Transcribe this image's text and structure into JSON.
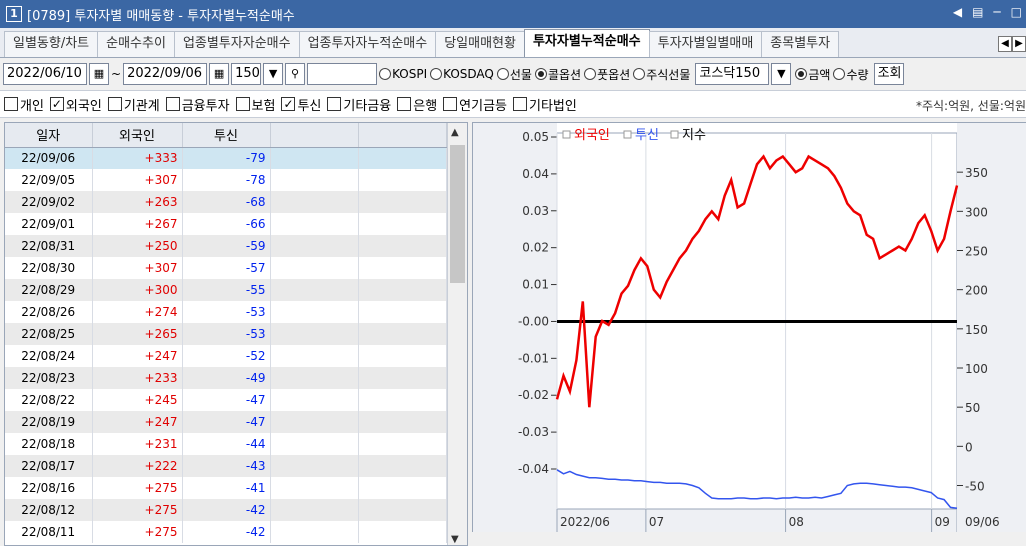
{
  "titlebar": {
    "window_number": "1",
    "title": "[0789] 투자자별 매매동향 - 투자자별누적순매수",
    "controls": [
      "◀",
      "▤",
      "─",
      "□"
    ]
  },
  "tabs": [
    {
      "label": "일별동향/차트",
      "active": false
    },
    {
      "label": "순매수추이",
      "active": false
    },
    {
      "label": "업종별투자자순매수",
      "active": false
    },
    {
      "label": "업종투자자누적순매수",
      "active": false
    },
    {
      "label": "당일매매현황",
      "active": false
    },
    {
      "label": "투자자별누적순매수",
      "active": true
    },
    {
      "label": "투자자별일별매매",
      "active": false
    },
    {
      "label": "종목별투자",
      "active": false
    }
  ],
  "toolbar": {
    "start_date": "2022/06/10",
    "range_sep": "~",
    "end_date": "2022/09/06",
    "count": "150",
    "search_icon": "search-icon",
    "market_options": [
      {
        "label": "KOSPI",
        "selected": false
      },
      {
        "label": "KOSDAQ",
        "selected": false
      },
      {
        "label": "선물",
        "selected": false
      },
      {
        "label": "콜옵션",
        "selected": true
      },
      {
        "label": "풋옵션",
        "selected": false
      },
      {
        "label": "주식선물",
        "selected": false
      }
    ],
    "combo_value": "코스닥150",
    "unit_options": [
      {
        "label": "금액",
        "selected": true
      },
      {
        "label": "수량",
        "selected": false
      }
    ],
    "query_button": "조회"
  },
  "investors": [
    {
      "label": "개인",
      "checked": false
    },
    {
      "label": "외국인",
      "checked": true
    },
    {
      "label": "기관계",
      "checked": false
    },
    {
      "label": "금융투자",
      "checked": false
    },
    {
      "label": "보험",
      "checked": false
    },
    {
      "label": "투신",
      "checked": true
    },
    {
      "label": "기타금융",
      "checked": false
    },
    {
      "label": "은행",
      "checked": false
    },
    {
      "label": "연기금등",
      "checked": false
    },
    {
      "label": "기타법인",
      "checked": false
    }
  ],
  "unit_note": "*주식:억원, 선물:억원",
  "grid": {
    "headers": [
      "일자",
      "외국인",
      "투신",
      "",
      ""
    ],
    "rows": [
      [
        "22/09/06",
        "+333",
        "-79"
      ],
      [
        "22/09/05",
        "+307",
        "-78"
      ],
      [
        "22/09/02",
        "+263",
        "-68"
      ],
      [
        "22/09/01",
        "+267",
        "-66"
      ],
      [
        "22/08/31",
        "+250",
        "-59"
      ],
      [
        "22/08/30",
        "+307",
        "-57"
      ],
      [
        "22/08/29",
        "+300",
        "-55"
      ],
      [
        "22/08/26",
        "+274",
        "-53"
      ],
      [
        "22/08/25",
        "+265",
        "-53"
      ],
      [
        "22/08/24",
        "+247",
        "-52"
      ],
      [
        "22/08/23",
        "+233",
        "-49"
      ],
      [
        "22/08/22",
        "+245",
        "-47"
      ],
      [
        "22/08/19",
        "+247",
        "-47"
      ],
      [
        "22/08/18",
        "+231",
        "-44"
      ],
      [
        "22/08/17",
        "+222",
        "-43"
      ],
      [
        "22/08/16",
        "+275",
        "-41"
      ],
      [
        "22/08/12",
        "+275",
        "-42"
      ],
      [
        "22/08/11",
        "+275",
        "-42"
      ]
    ]
  },
  "chart_data": {
    "type": "line",
    "legend": [
      "외국인",
      "투신",
      "지수"
    ],
    "colors": {
      "외국인": "#ee0000",
      "투신": "#3355ee",
      "지수": "#000000",
      "legend_marker": "#999999"
    },
    "left_ticks": [
      "0.05",
      "0.04",
      "0.03",
      "0.02",
      "0.01",
      "-0.00",
      "-0.01",
      "-0.02",
      "-0.03",
      "-0.04"
    ],
    "left_values": [
      0.05,
      0.04,
      0.03,
      0.02,
      0.01,
      0.0,
      -0.01,
      -0.02,
      -0.03,
      -0.04
    ],
    "right_ticks": [
      "350",
      "300",
      "250",
      "200",
      "150",
      "100",
      "50",
      "0",
      "-50"
    ],
    "right_values": [
      350,
      300,
      250,
      200,
      150,
      100,
      50,
      0,
      -50
    ],
    "right_ylim": [
      -80,
      400
    ],
    "x_labels": [
      {
        "label": "2022/06",
        "x": 0
      },
      {
        "label": "07",
        "x": 14
      },
      {
        "label": "08",
        "x": 36
      },
      {
        "label": "09",
        "x": 59
      },
      {
        "label": "09/06",
        "x": 62
      }
    ],
    "x_range": [
      0,
      63
    ],
    "index_level": 0.0,
    "series": [
      {
        "name": "외국인",
        "values": [
          60,
          90,
          70,
          110,
          185,
          50,
          140,
          160,
          155,
          170,
          195,
          205,
          225,
          240,
          230,
          200,
          190,
          210,
          225,
          240,
          250,
          265,
          275,
          290,
          300,
          290,
          320,
          340,
          305,
          310,
          335,
          360,
          370,
          355,
          365,
          370,
          360,
          350,
          355,
          370,
          365,
          360,
          355,
          345,
          330,
          310,
          300,
          295,
          270,
          265,
          240,
          245,
          250,
          255,
          250,
          265,
          285,
          295,
          275,
          250,
          265,
          300,
          333
        ]
      },
      {
        "name": "투신",
        "values": [
          -30,
          -35,
          -32,
          -36,
          -38,
          -40,
          -40,
          -41,
          -42,
          -42,
          -43,
          -43,
          -44,
          -44,
          -45,
          -46,
          -46,
          -47,
          -47,
          -47,
          -48,
          -50,
          -53,
          -60,
          -66,
          -67,
          -67,
          -67,
          -66,
          -66,
          -67,
          -67,
          -66,
          -66,
          -67,
          -66,
          -66,
          -65,
          -66,
          -66,
          -65,
          -66,
          -64,
          -62,
          -60,
          -50,
          -48,
          -47,
          -47,
          -48,
          -49,
          -50,
          -51,
          -52,
          -52,
          -53,
          -55,
          -57,
          -59,
          -66,
          -68,
          -78,
          -79
        ]
      }
    ]
  },
  "hscroll_buttons": [
    "▶",
    "◀◀",
    "■",
    "▶▶"
  ]
}
